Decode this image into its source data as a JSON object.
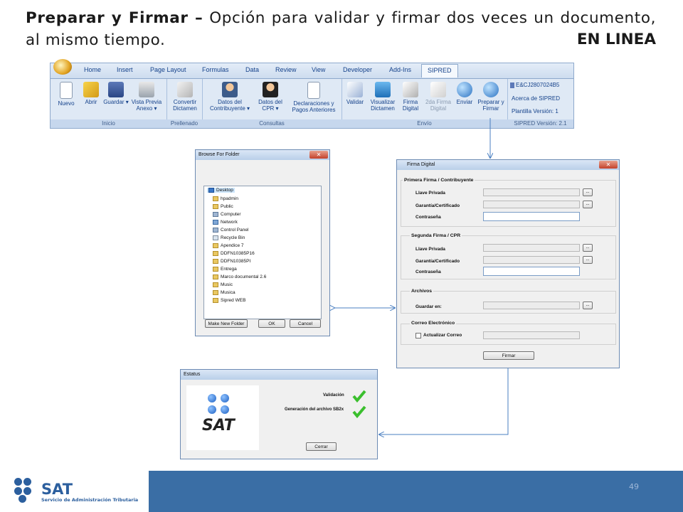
{
  "heading": {
    "bold_part": "Preparar y Firmar –",
    "rest": " Opción para validar y firmar dos veces un documento, al mismo tiempo.",
    "badge": "EN LINEA"
  },
  "ribbon": {
    "tabs": [
      "Home",
      "Insert",
      "Page Layout",
      "Formulas",
      "Data",
      "Review",
      "View",
      "Developer",
      "Add-Ins",
      "SIPRED"
    ],
    "groups": {
      "inicio": {
        "label": "Inicio",
        "buttons": [
          {
            "label": "Nuevo"
          },
          {
            "label": "Abrir"
          },
          {
            "label": "Guardar ▾"
          },
          {
            "label": "Vista Previa Anexo ▾"
          }
        ]
      },
      "prellenado": {
        "label": "Prellenado",
        "buttons": [
          {
            "label": "Convertir Dictamen"
          }
        ]
      },
      "consultas": {
        "label": "Consultas",
        "buttons": [
          {
            "label": "Datos del Contribuyente ▾"
          },
          {
            "label": "Datos del CPR ▾"
          },
          {
            "label": "Declaraciones y Pagos Anteriores"
          }
        ]
      },
      "envio": {
        "label": "Envío",
        "buttons": [
          {
            "label": "Validar"
          },
          {
            "label": "Visualizar Dictamen"
          },
          {
            "label": "Firma Digital"
          },
          {
            "label": "2da Firma Digital"
          },
          {
            "label": "Enviar"
          },
          {
            "label": "Preparar y Firmar"
          }
        ]
      }
    },
    "info": {
      "rfc": "E&CJ2807024B5",
      "about": "Acerca de SIPRED",
      "plantilla": "Plantilla Versión: 1",
      "sipred_version": "SIPRED Versión: 2.1"
    }
  },
  "browse_dialog": {
    "title": "Browse For Folder",
    "close": "✕",
    "items": [
      "Desktop",
      "hpadmin",
      "Public",
      "Computer",
      "Network",
      "Control Panel",
      "Recycle Bin",
      "Apendice 7",
      "DDFN10385P16",
      "DDFN10385PI",
      "Entrega",
      "Marco documental 2.6",
      "Music",
      "Musica",
      "Sipred WEB"
    ],
    "buttons": {
      "new_folder": "Make New Folder",
      "ok": "OK",
      "cancel": "Cancel"
    }
  },
  "firma_dialog": {
    "title": "Firma Digital",
    "close": "✕",
    "primera": {
      "section": "Primera Firma / Contribuyente",
      "llave": "Llave Privada",
      "garantia": "Garantía/Certificado",
      "contrasena": "Contraseña"
    },
    "segunda": {
      "section": "Segunda Firma / CPR",
      "llave": "Llave Privada",
      "garantia": "Garantía/Certificado",
      "contrasena": "Contraseña"
    },
    "archivos": {
      "section": "Archivos",
      "guardar": "Guardar en:"
    },
    "correo": {
      "section": "Correo Electrónico",
      "actualizar": "Actualizar Correo"
    },
    "ellipsis": "...",
    "firmar": "Firmar"
  },
  "status_dialog": {
    "title": "Estatus",
    "logo_text": "SAT",
    "validacion": "Validación",
    "generacion": "Generación del archivo SB2x",
    "cerrar": "Cerrar"
  },
  "footer": {
    "logo": "SAT",
    "logo_sub": "Servicio de Administración Tributaria",
    "page": "49"
  },
  "colors": {
    "footer_bar": "#3a6ea5",
    "ribbon_bg": "#dfe9f5",
    "arrow": "#4a7fc1",
    "check": "#3bbf2e"
  }
}
